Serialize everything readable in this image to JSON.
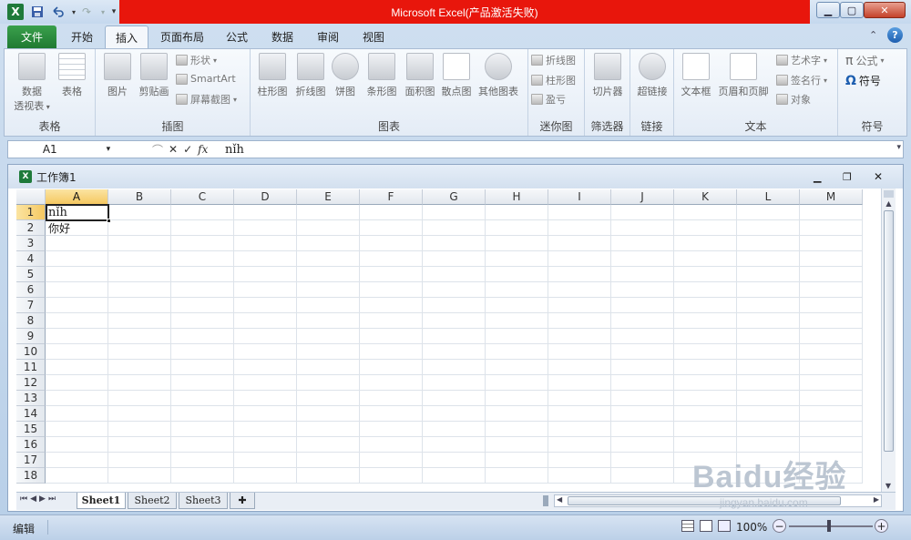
{
  "window": {
    "title": "Microsoft Excel(产品激活失败)",
    "title_bar_color": "#e8160c"
  },
  "tabs": [
    {
      "label": "文件",
      "active": false
    },
    {
      "label": "开始",
      "active": false
    },
    {
      "label": "插入",
      "active": true
    },
    {
      "label": "页面布局",
      "active": false
    },
    {
      "label": "公式",
      "active": false
    },
    {
      "label": "数据",
      "active": false
    },
    {
      "label": "审阅",
      "active": false
    },
    {
      "label": "视图",
      "active": false
    }
  ],
  "ribbon": {
    "groups": {
      "tables": {
        "label": "表格",
        "pivot_line1": "数据",
        "pivot_line2": "透视表",
        "table": "表格"
      },
      "illustrations": {
        "label": "插图",
        "picture": "图片",
        "clipart": "剪贴画",
        "shapes": "形状",
        "smartart": "SmartArt",
        "screenshot": "屏幕截图"
      },
      "charts": {
        "label": "图表",
        "column": "柱形图",
        "line": "折线图",
        "pie": "饼图",
        "bar": "条形图",
        "area": "面积图",
        "scatter": "散点图",
        "other": "其他图表"
      },
      "sparklines": {
        "label": "迷你图",
        "line": "折线图",
        "column": "柱形图",
        "winloss": "盈亏"
      },
      "filter": {
        "label": "筛选器",
        "slicer": "切片器"
      },
      "links": {
        "label": "链接",
        "hyperlink": "超链接"
      },
      "text": {
        "label": "文本",
        "textbox": "文本框",
        "header_footer": "页眉和页脚",
        "wordart": "艺术字",
        "signature": "签名行",
        "object": "对象"
      },
      "symbols": {
        "label": "符号",
        "equation": "公式",
        "symbol": "符号"
      }
    }
  },
  "formula_bar": {
    "name_box": "A1",
    "formula": "nǐh"
  },
  "workbook": {
    "title": "工作簿1",
    "columns": [
      "A",
      "B",
      "C",
      "D",
      "E",
      "F",
      "G",
      "H",
      "I",
      "J",
      "K",
      "L",
      "M"
    ],
    "rows": [
      "1",
      "2",
      "3",
      "4",
      "5",
      "6",
      "7",
      "8",
      "9",
      "10",
      "11",
      "12",
      "13",
      "14",
      "15",
      "16",
      "17",
      "18"
    ],
    "selected_cell": "A1",
    "cells": {
      "A1": "nǐh",
      "A2": "你好"
    },
    "sheets": [
      "Sheet1",
      "Sheet2",
      "Sheet3"
    ],
    "active_sheet": "Sheet1"
  },
  "status": {
    "mode": "编辑",
    "zoom": "100%"
  },
  "watermark": {
    "brand": "Baidu经验",
    "url": "jingyan.baidu.com"
  }
}
